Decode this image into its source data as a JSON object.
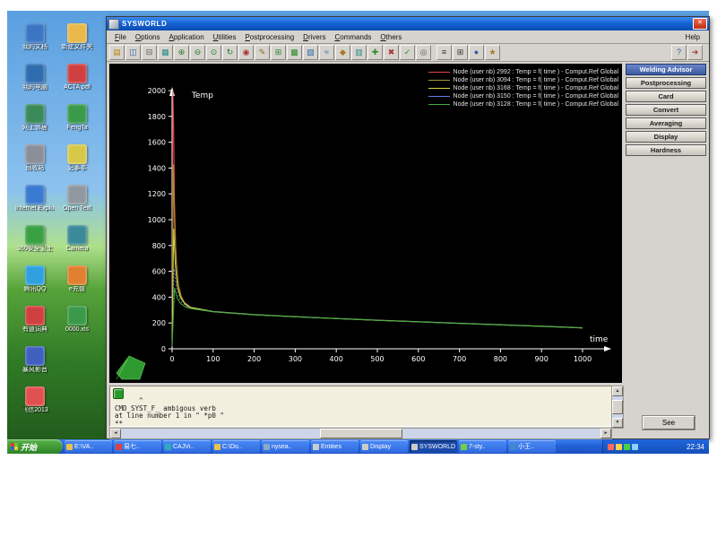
{
  "window": {
    "title": "SYSWORLD",
    "close_glyph": "✕"
  },
  "menubar": {
    "items": [
      "File",
      "Options",
      "Application",
      "Utilities",
      "Postprocessing",
      "Drivers",
      "Commands",
      "Others"
    ],
    "help": "Help"
  },
  "toolbar": {
    "groups": [
      [
        {
          "name": "open-file-icon",
          "glyph": "▤",
          "color": "#b8860b"
        },
        {
          "name": "save-icon",
          "glyph": "◫",
          "color": "#2a5aa8"
        },
        {
          "name": "print-icon",
          "glyph": "⊟",
          "color": "#555555"
        },
        {
          "name": "settings-icon",
          "glyph": "▦",
          "color": "#2a8a8a"
        },
        {
          "name": "zoom-in-icon",
          "glyph": "⊕",
          "color": "#2a7a2a"
        },
        {
          "name": "zoom-out-icon",
          "glyph": "⊖",
          "color": "#2a7a2a"
        },
        {
          "name": "fit-view-icon",
          "glyph": "⊙",
          "color": "#2a7a2a"
        },
        {
          "name": "rotate-icon",
          "glyph": "↻",
          "color": "#2a7a2a"
        },
        {
          "name": "select-node-icon",
          "glyph": "◉",
          "color": "#aa3333"
        },
        {
          "name": "edit-icon",
          "glyph": "✎",
          "color": "#8a6a1a"
        },
        {
          "name": "grid-icon",
          "glyph": "⊞",
          "color": "#2a8a2a"
        },
        {
          "name": "mesh-icon",
          "glyph": "▩",
          "color": "#2a8a2a"
        },
        {
          "name": "contour-icon",
          "glyph": "▧",
          "color": "#2a66aa"
        },
        {
          "name": "curves-icon",
          "glyph": "≈",
          "color": "#2a66aa"
        },
        {
          "name": "palette-icon",
          "glyph": "◆",
          "color": "#aa7722"
        },
        {
          "name": "layers-icon",
          "glyph": "▥",
          "color": "#2a8a8a"
        },
        {
          "name": "add-icon",
          "glyph": "✚",
          "color": "#2a8a2a"
        },
        {
          "name": "delete-icon",
          "glyph": "✖",
          "color": "#aa3333"
        },
        {
          "name": "apply-icon",
          "glyph": "✓",
          "color": "#2a8a2a"
        },
        {
          "name": "snapshot-icon",
          "glyph": "◎",
          "color": "#555555"
        }
      ],
      [
        {
          "name": "node-list-icon",
          "glyph": "≡",
          "color": "#333333"
        },
        {
          "name": "table-icon",
          "glyph": "⊞",
          "color": "#333333"
        },
        {
          "name": "info-icon",
          "glyph": "●",
          "color": "#2a5aa8"
        },
        {
          "name": "tools-icon",
          "glyph": "★",
          "color": "#aa7722"
        }
      ],
      [
        {
          "name": "help-cursor-icon",
          "glyph": "?",
          "color": "#2a5aa8"
        },
        {
          "name": "exit-icon",
          "glyph": "➜",
          "color": "#aa3333"
        }
      ]
    ]
  },
  "right_panel": {
    "buttons": [
      {
        "id": "welding-advisor",
        "label": "Welding Advisor",
        "active": true
      },
      {
        "id": "postprocessing",
        "label": "Postprocessing",
        "active": false
      },
      {
        "id": "card",
        "label": "Card",
        "active": false
      },
      {
        "id": "convert",
        "label": "Convert",
        "active": false
      },
      {
        "id": "averaging",
        "label": "Averaging",
        "active": false
      },
      {
        "id": "display",
        "label": "Display",
        "active": false
      },
      {
        "id": "hardness",
        "label": "Hardness",
        "active": false
      }
    ]
  },
  "chart_data": {
    "type": "line",
    "title": "",
    "xlabel": "time",
    "ylabel": "Temp",
    "xlim": [
      0,
      1000
    ],
    "ylim": [
      0,
      2000
    ],
    "xticks": [
      0,
      100,
      200,
      300,
      400,
      500,
      600,
      700,
      800,
      900,
      1000
    ],
    "yticks": [
      0,
      200,
      400,
      600,
      800,
      1000,
      1200,
      1400,
      1600,
      1800,
      2000
    ],
    "grid": false,
    "legend_position": "top-right",
    "background": "#000000",
    "axis_color": "#ffffff",
    "series": [
      {
        "id": "node-2992",
        "name": "Node (user nb) 2992 : Temp = f( time ) -  Comput.Ref Global",
        "color": "#e04848",
        "dash": false,
        "points": [
          [
            0,
            22
          ],
          [
            2,
            1998
          ],
          [
            4,
            1700
          ],
          [
            6,
            1150
          ],
          [
            9,
            780
          ],
          [
            13,
            560
          ],
          [
            18,
            440
          ],
          [
            25,
            375
          ],
          [
            35,
            335
          ],
          [
            45,
            315
          ],
          [
            100,
            287
          ],
          [
            200,
            264
          ],
          [
            300,
            248
          ],
          [
            400,
            234
          ],
          [
            500,
            221
          ],
          [
            600,
            209
          ],
          [
            700,
            197
          ],
          [
            800,
            186
          ],
          [
            900,
            174
          ],
          [
            1000,
            162
          ]
        ]
      },
      {
        "id": "node-3094",
        "name": "Node (user nb) 3094 : Temp = f( time ) -  Comput.Ref Global",
        "color": "#9a9a30",
        "dash": false,
        "points": [
          [
            0,
            22
          ],
          [
            3,
            1430
          ],
          [
            6,
            980
          ],
          [
            10,
            680
          ],
          [
            15,
            500
          ],
          [
            22,
            410
          ],
          [
            30,
            360
          ],
          [
            45,
            322
          ],
          [
            100,
            289
          ],
          [
            200,
            265
          ],
          [
            300,
            249
          ],
          [
            400,
            235
          ],
          [
            500,
            222
          ],
          [
            600,
            210
          ],
          [
            700,
            198
          ],
          [
            800,
            187
          ],
          [
            900,
            175
          ],
          [
            1000,
            163
          ]
        ]
      },
      {
        "id": "node-3168",
        "name": "Node (user nb) 3168 : Temp = f( time ) -  Comput.Ref Global",
        "color": "#d8d848",
        "dash": false,
        "points": [
          [
            0,
            22
          ],
          [
            4,
            930
          ],
          [
            8,
            640
          ],
          [
            13,
            480
          ],
          [
            20,
            400
          ],
          [
            30,
            352
          ],
          [
            45,
            320
          ],
          [
            100,
            288
          ],
          [
            200,
            264
          ],
          [
            300,
            248
          ],
          [
            400,
            234
          ],
          [
            500,
            221
          ],
          [
            600,
            209
          ],
          [
            700,
            197
          ],
          [
            800,
            186
          ],
          [
            900,
            174
          ],
          [
            1000,
            162
          ]
        ]
      },
      {
        "id": "node-3150",
        "name": "Node (user nb) 3150 : Temp = f( time ) -  Comput.Ref Global",
        "color": "#5b7fe0",
        "dash": true,
        "points": [
          [
            0,
            22
          ],
          [
            5,
            620
          ],
          [
            10,
            470
          ],
          [
            16,
            400
          ],
          [
            24,
            358
          ],
          [
            35,
            330
          ],
          [
            50,
            310
          ],
          [
            100,
            290
          ],
          [
            200,
            266
          ],
          [
            300,
            250
          ],
          [
            400,
            236
          ],
          [
            500,
            223
          ],
          [
            600,
            211
          ],
          [
            700,
            199
          ],
          [
            800,
            188
          ],
          [
            900,
            176
          ],
          [
            1000,
            164
          ]
        ]
      },
      {
        "id": "node-3128",
        "name": "Node (user nb) 3128 : Temp = f( time ) -  Comput.Ref Global",
        "color": "#3fae3f",
        "dash": false,
        "points": [
          [
            0,
            22
          ],
          [
            6,
            470
          ],
          [
            12,
            395
          ],
          [
            20,
            352
          ],
          [
            32,
            325
          ],
          [
            45,
            312
          ],
          [
            100,
            286
          ],
          [
            200,
            263
          ],
          [
            300,
            247
          ],
          [
            400,
            233
          ],
          [
            500,
            220
          ],
          [
            600,
            208
          ],
          [
            700,
            196
          ],
          [
            800,
            185
          ],
          [
            900,
            173
          ],
          [
            1000,
            161
          ]
        ]
      }
    ]
  },
  "console": {
    "lines": [
      "      ^",
      "CMD_SYST_F_ ambigous verb",
      "at line number 1 in \" *p0 \"",
      "**"
    ]
  },
  "scrollbars": {
    "up": "▲",
    "down": "▼",
    "left": "◄",
    "right": "►"
  },
  "footer": {
    "see_label": "See"
  },
  "desktop": {
    "icons": [
      {
        "id": "my-documents",
        "label": "我的文档",
        "color": "#3b76c4",
        "col": 0,
        "row": 0
      },
      {
        "id": "my-computer",
        "label": "我的电脑",
        "color": "#2f6db0",
        "col": 0,
        "row": 1
      },
      {
        "id": "network-places",
        "label": "网上邻居",
        "color": "#3a8a5a",
        "col": 0,
        "row": 2
      },
      {
        "id": "recycle-bin",
        "label": "回收站",
        "color": "#8a8f98",
        "col": 0,
        "row": 3
      },
      {
        "id": "internet-explorer",
        "label": "Internet Explorer",
        "color": "#3a7ad0",
        "col": 0,
        "row": 4
      },
      {
        "id": "safe360",
        "label": "360安全卫士",
        "color": "#3aa044",
        "col": 0,
        "row": 5
      },
      {
        "id": "qq",
        "label": "腾讯QQ",
        "color": "#30a0e0",
        "col": 0,
        "row": 6
      },
      {
        "id": "youdao",
        "label": "有道词典",
        "color": "#d04040",
        "col": 0,
        "row": 7
      },
      {
        "id": "baofeng",
        "label": "暴风影音",
        "color": "#4060c0",
        "col": 0,
        "row": 8
      },
      {
        "id": "fetion",
        "label": "飞信2013",
        "color": "#e05050",
        "col": 0,
        "row": 9
      },
      {
        "id": "new-folder",
        "label": "新建文件夹",
        "color": "#e8b84a",
        "col": 1,
        "row": 0
      },
      {
        "id": "acta-pdf",
        "label": "ACTA.pdf",
        "color": "#d04040",
        "col": 1,
        "row": 1
      },
      {
        "id": "fengta",
        "label": "FengTa",
        "color": "#3a9a4a",
        "col": 1,
        "row": 2
      },
      {
        "id": "notepad",
        "label": "记事本",
        "color": "#d8c84a",
        "col": 1,
        "row": 3
      },
      {
        "id": "open-text",
        "label": "Open Text",
        "color": "#9098a0",
        "col": 1,
        "row": 4
      },
      {
        "id": "camera",
        "label": "Camera",
        "color": "#3a8a9a",
        "col": 1,
        "row": 5
      },
      {
        "id": "e-charge",
        "label": "e充值",
        "color": "#e08030",
        "col": 1,
        "row": 6
      },
      {
        "id": "xls-0000",
        "label": "0000.xls",
        "color": "#3a9a4a",
        "col": 1,
        "row": 7
      }
    ]
  },
  "taskbar": {
    "start_label": "开始",
    "clock": "22:34",
    "tasks": [
      {
        "id": "eva-folder",
        "label": "E:\\VA..",
        "icon_color": "#e8c24a",
        "active": false
      },
      {
        "id": "yiqi",
        "label": "易七..",
        "icon_color": "#d84444",
        "active": false
      },
      {
        "id": "cajviewer",
        "label": "CAJVi..",
        "icon_color": "#33aabb",
        "active": false
      },
      {
        "id": "cdo-folder",
        "label": "C:\\Do..",
        "icon_color": "#e8c24a",
        "active": false
      },
      {
        "id": "nysea",
        "label": "nysea..",
        "icon_color": "#88aacc",
        "active": false
      },
      {
        "id": "entities",
        "label": "Entities",
        "icon_color": "#cccccc",
        "active": false
      },
      {
        "id": "display",
        "label": "Display",
        "icon_color": "#cccccc",
        "active": false
      },
      {
        "id": "sysworld",
        "label": "SYSWORLD",
        "icon_color": "#cccccc",
        "active": true
      },
      {
        "id": "seven-sty",
        "label": "7-sty..",
        "icon_color": "#77cc44",
        "active": false
      },
      {
        "id": "xiaowang",
        "label": "小王..",
        "icon_color": "#4488cc",
        "active": false
      }
    ],
    "tray_icons": [
      {
        "id": "volume",
        "color": "#8fd0ff"
      },
      {
        "id": "antivirus",
        "color": "#4ad04a"
      },
      {
        "id": "network-status",
        "color": "#ffd24a"
      },
      {
        "id": "messenger",
        "color": "#ff6a5a"
      }
    ]
  }
}
